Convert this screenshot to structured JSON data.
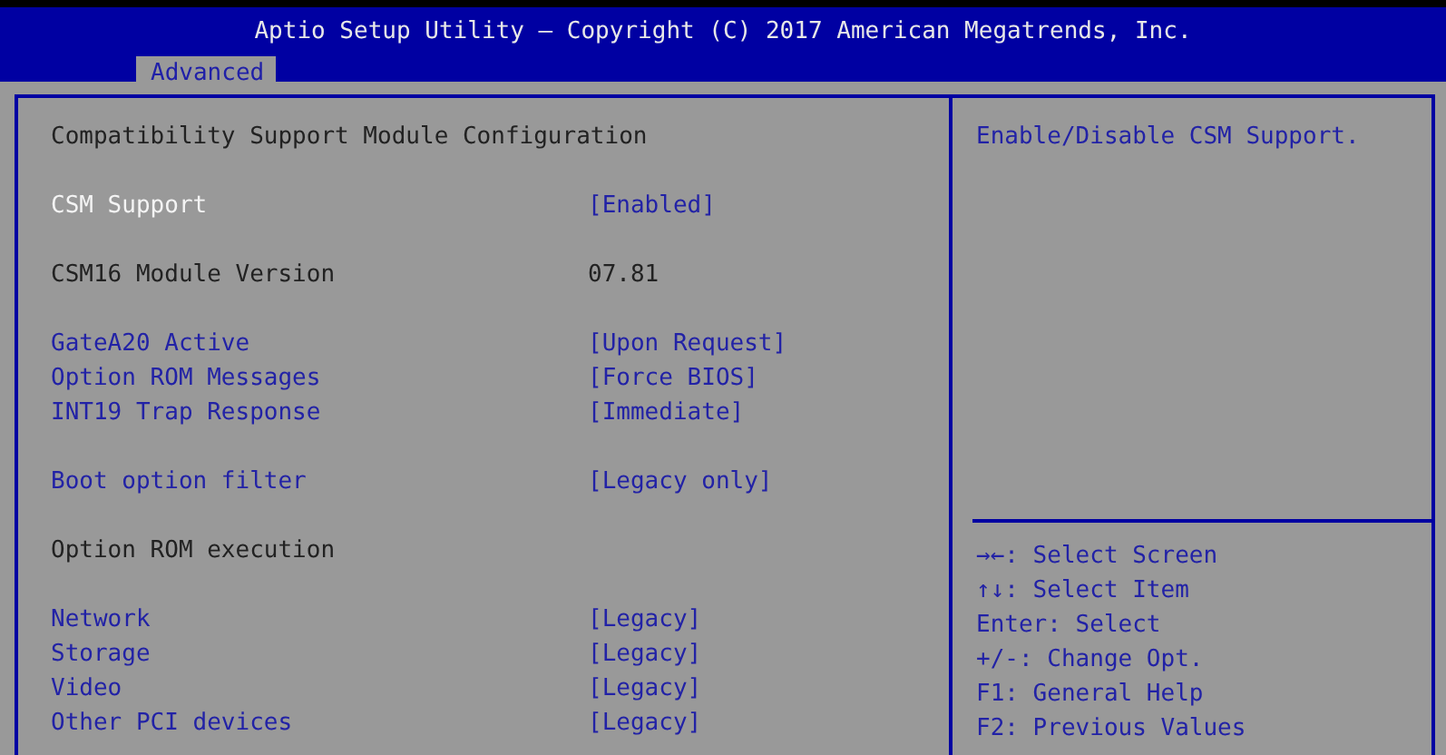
{
  "window": {
    "title": "Aptio Setup Utility – Copyright (C) 2017 American Megatrends, Inc."
  },
  "tabs": [
    {
      "label": "Advanced",
      "selected": true
    }
  ],
  "settings": {
    "groups": [
      {
        "rows": [
          {
            "kind": "heading",
            "label": "Compatibility Support Module Configuration",
            "selected": false
          }
        ]
      },
      {
        "rows": [
          {
            "kind": "option",
            "label": "CSM Support",
            "value": "[Enabled]",
            "selected": true
          }
        ]
      },
      {
        "rows": [
          {
            "kind": "info",
            "label": "CSM16 Module Version",
            "value": "07.81",
            "selected": false
          }
        ]
      },
      {
        "rows": [
          {
            "kind": "option",
            "label": "GateA20 Active",
            "value": "[Upon Request]",
            "selected": false
          },
          {
            "kind": "option",
            "label": "Option ROM Messages",
            "value": "[Force BIOS]",
            "selected": false
          },
          {
            "kind": "option",
            "label": "INT19 Trap Response",
            "value": "[Immediate]",
            "selected": false
          }
        ]
      },
      {
        "rows": [
          {
            "kind": "option",
            "label": "Boot option filter",
            "value": "[Legacy only]",
            "selected": false
          }
        ]
      },
      {
        "rows": [
          {
            "kind": "heading",
            "label": "Option ROM execution",
            "selected": false
          }
        ]
      },
      {
        "rows": [
          {
            "kind": "option",
            "label": "Network",
            "value": "[Legacy]",
            "selected": false
          },
          {
            "kind": "option",
            "label": "Storage",
            "value": "[Legacy]",
            "selected": false
          },
          {
            "kind": "option",
            "label": "Video",
            "value": "[Legacy]",
            "selected": false
          },
          {
            "kind": "option",
            "label": "Other PCI devices",
            "value": "[Legacy]",
            "selected": false
          }
        ]
      }
    ]
  },
  "help": {
    "description": "Enable/Disable CSM Support.",
    "keys": [
      "→←: Select Screen",
      "↑↓: Select Item",
      "Enter: Select",
      "+/-: Change Opt.",
      "F1: General Help",
      "F2: Previous Values"
    ]
  }
}
